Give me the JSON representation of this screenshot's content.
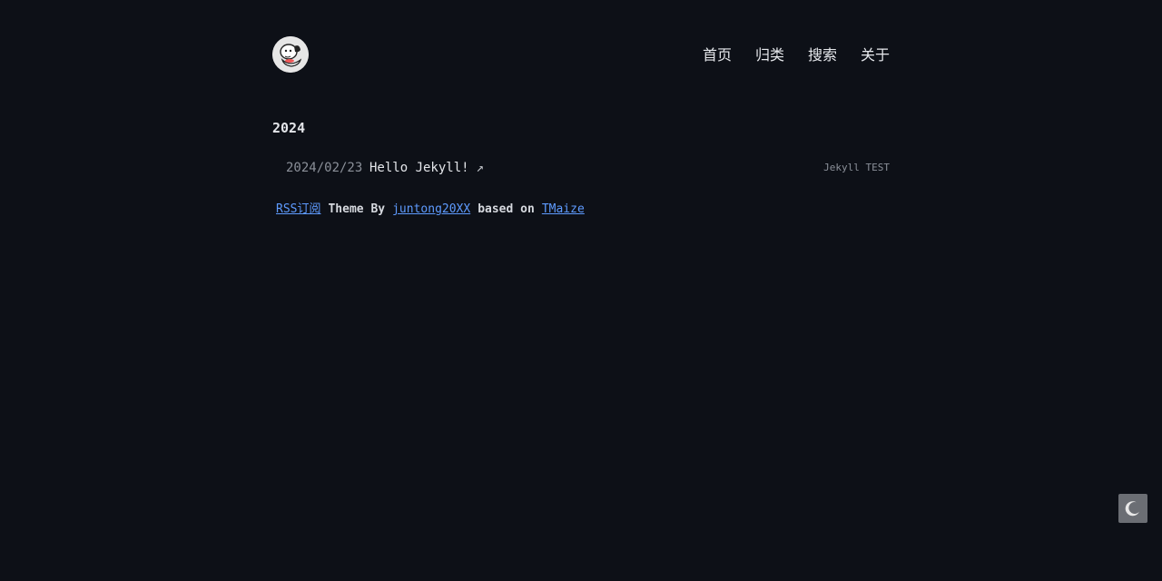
{
  "header": {
    "avatar_icon": "dog-avatar-icon",
    "nav": [
      {
        "label": "首页"
      },
      {
        "label": "归类"
      },
      {
        "label": "搜索"
      },
      {
        "label": "关于"
      }
    ]
  },
  "archive": {
    "year": "2024",
    "posts": [
      {
        "date": "2024/02/23",
        "title": "Hello Jekyll!",
        "arrow": "↗",
        "tags": "Jekyll TEST"
      }
    ]
  },
  "footer": {
    "rss_label": "RSS订阅",
    "theme_by": "Theme By",
    "author_link": "juntong20XX",
    "based_on": "based on",
    "base_theme_link": "TMaize"
  },
  "theme_toggle": {
    "icon": "moon-icon"
  },
  "colors": {
    "background": "#0d1017",
    "link": "#5e9bff"
  }
}
